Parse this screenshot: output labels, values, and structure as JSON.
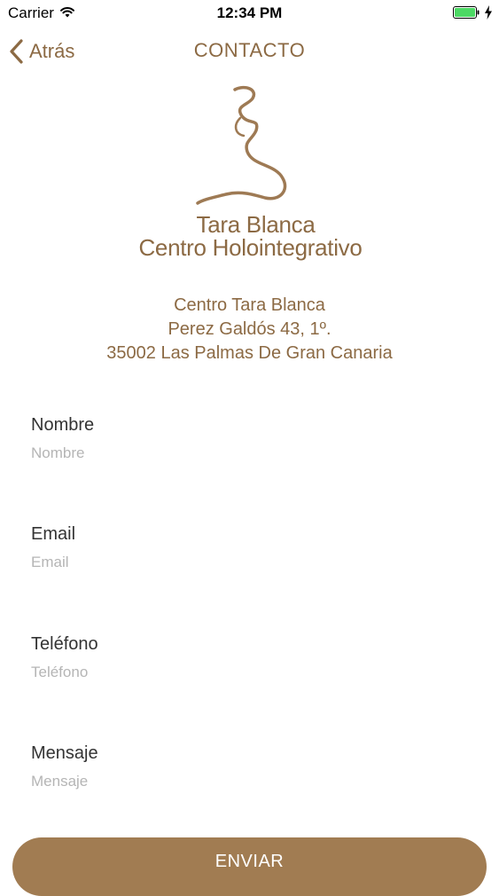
{
  "status_bar": {
    "carrier": "Carrier",
    "time": "12:34 PM",
    "battery_color": "#4cd964"
  },
  "nav": {
    "back_label": "Atrás",
    "title": "CONTACTO",
    "accent_color": "#8c6a44"
  },
  "logo": {
    "line1": "Tara Blanca",
    "line2": "Centro Holointegrativo"
  },
  "address": {
    "line1": "Centro Tara Blanca",
    "line2": "Perez Galdós 43, 1º.",
    "line3": "35002 Las Palmas De Gran Canaria"
  },
  "form": {
    "fields": [
      {
        "label": "Nombre",
        "placeholder": "Nombre",
        "value": ""
      },
      {
        "label": "Email",
        "placeholder": "Email",
        "value": ""
      },
      {
        "label": "Teléfono",
        "placeholder": "Teléfono",
        "value": ""
      },
      {
        "label": "Mensaje",
        "placeholder": "Mensaje",
        "value": ""
      }
    ],
    "submit_label": "ENVIAR",
    "button_color": "#a17c52"
  }
}
